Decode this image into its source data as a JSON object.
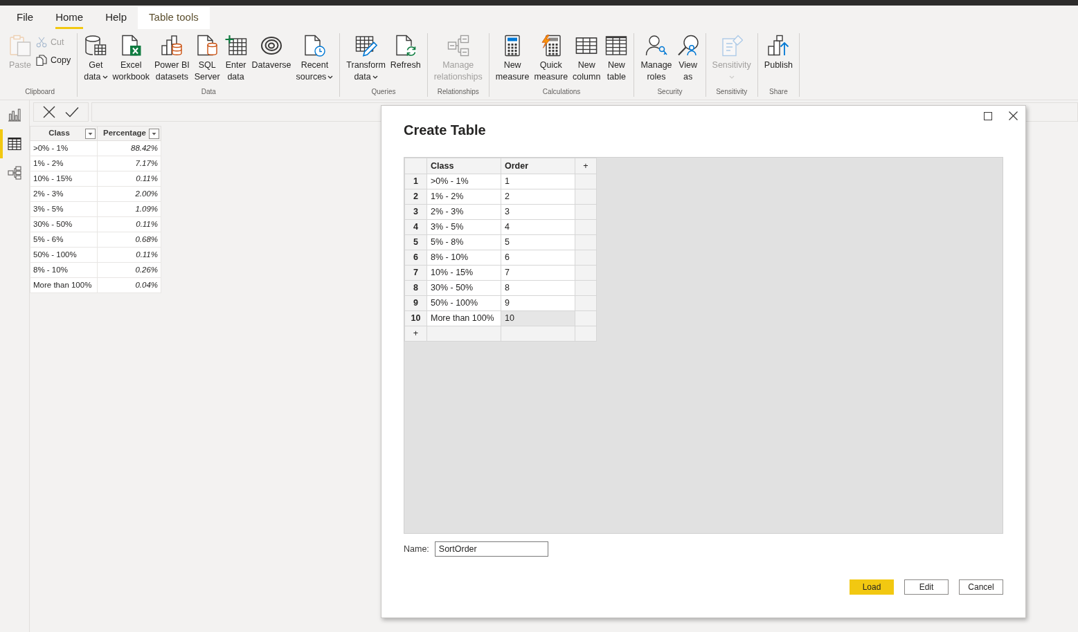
{
  "tabs": [
    {
      "label": "File",
      "selected": false,
      "kind": "standard"
    },
    {
      "label": "Home",
      "selected": true,
      "kind": "standard"
    },
    {
      "label": "Help",
      "selected": false,
      "kind": "standard"
    },
    {
      "label": "Table tools",
      "selected": false,
      "kind": "contextual"
    }
  ],
  "ribbon": {
    "groups": [
      {
        "label": "Clipboard",
        "items": [
          {
            "kind": "large",
            "lines": [
              "Paste"
            ],
            "disabled": true,
            "dropdown": false
          },
          {
            "kind": "small",
            "lines": [
              "Cut"
            ],
            "disabled": true,
            "dropdown": false
          },
          {
            "kind": "small",
            "lines": [
              "Copy"
            ],
            "disabled": false,
            "dropdown": false
          }
        ]
      },
      {
        "label": "Data",
        "items": [
          {
            "kind": "large",
            "lines": [
              "Get",
              "data"
            ],
            "disabled": false,
            "dropdown": true
          },
          {
            "kind": "large",
            "lines": [
              "Excel",
              "workbook"
            ],
            "disabled": false,
            "dropdown": false
          },
          {
            "kind": "large",
            "lines": [
              "Power BI",
              "datasets"
            ],
            "disabled": false,
            "dropdown": false
          },
          {
            "kind": "large",
            "lines": [
              "SQL",
              "Server"
            ],
            "disabled": false,
            "dropdown": false
          },
          {
            "kind": "large",
            "lines": [
              "Enter",
              "data"
            ],
            "disabled": false,
            "dropdown": false
          },
          {
            "kind": "large",
            "lines": [
              "Dataverse"
            ],
            "disabled": false,
            "dropdown": false
          },
          {
            "kind": "large",
            "lines": [
              "Recent",
              "sources"
            ],
            "disabled": false,
            "dropdown": true
          }
        ]
      },
      {
        "label": "Queries",
        "items": [
          {
            "kind": "large",
            "lines": [
              "Transform",
              "data"
            ],
            "disabled": false,
            "dropdown": true
          },
          {
            "kind": "large",
            "lines": [
              "Refresh"
            ],
            "disabled": false,
            "dropdown": false
          }
        ]
      },
      {
        "label": "Relationships",
        "items": [
          {
            "kind": "large",
            "lines": [
              "Manage",
              "relationships"
            ],
            "disabled": true,
            "dropdown": false
          }
        ]
      },
      {
        "label": "Calculations",
        "items": [
          {
            "kind": "large",
            "lines": [
              "New",
              "measure"
            ],
            "disabled": false,
            "dropdown": false
          },
          {
            "kind": "large",
            "lines": [
              "Quick",
              "measure"
            ],
            "disabled": false,
            "dropdown": false
          },
          {
            "kind": "large",
            "lines": [
              "New",
              "column"
            ],
            "disabled": false,
            "dropdown": false
          },
          {
            "kind": "large",
            "lines": [
              "New",
              "table"
            ],
            "disabled": false,
            "dropdown": false
          }
        ]
      },
      {
        "label": "Security",
        "items": [
          {
            "kind": "large",
            "lines": [
              "Manage",
              "roles"
            ],
            "disabled": false,
            "dropdown": false
          },
          {
            "kind": "large",
            "lines": [
              "View",
              "as"
            ],
            "disabled": false,
            "dropdown": false
          }
        ]
      },
      {
        "label": "Sensitivity",
        "items": [
          {
            "kind": "large",
            "lines": [
              "Sensitivity"
            ],
            "disabled": true,
            "dropdown": true
          }
        ]
      },
      {
        "label": "Share",
        "items": [
          {
            "kind": "large",
            "lines": [
              "Publish"
            ],
            "disabled": false,
            "dropdown": false
          }
        ]
      }
    ]
  },
  "view_rail": [
    {
      "selected": false
    },
    {
      "selected": true
    },
    {
      "selected": false
    }
  ],
  "data_table": {
    "columns": [
      "Class",
      "Percentage"
    ],
    "rows": [
      [
        ">0% - 1%",
        "88.42%"
      ],
      [
        "1% - 2%",
        "7.17%"
      ],
      [
        "10% - 15%",
        "0.11%"
      ],
      [
        "2% - 3%",
        "2.00%"
      ],
      [
        "3% - 5%",
        "1.09%"
      ],
      [
        "30% - 50%",
        "0.11%"
      ],
      [
        "5% - 6%",
        "0.68%"
      ],
      [
        "50% - 100%",
        "0.11%"
      ],
      [
        "8% - 10%",
        "0.26%"
      ],
      [
        "More than 100%",
        "0.04%"
      ]
    ]
  },
  "dialog": {
    "title": "Create Table",
    "columns": [
      "Class",
      "Order"
    ],
    "add_column": "+",
    "add_row": "+",
    "rows": [
      {
        "number": "1",
        "cells": [
          {
            "text": ">0% - 1%",
            "selected": false
          },
          {
            "text": "1",
            "selected": false
          }
        ]
      },
      {
        "number": "2",
        "cells": [
          {
            "text": "1% - 2%",
            "selected": false
          },
          {
            "text": "2",
            "selected": false
          }
        ]
      },
      {
        "number": "3",
        "cells": [
          {
            "text": "2% - 3%",
            "selected": false
          },
          {
            "text": "3",
            "selected": false
          }
        ]
      },
      {
        "number": "4",
        "cells": [
          {
            "text": "3% - 5%",
            "selected": false
          },
          {
            "text": "4",
            "selected": false
          }
        ]
      },
      {
        "number": "5",
        "cells": [
          {
            "text": "5% - 8%",
            "selected": false
          },
          {
            "text": "5",
            "selected": false
          }
        ]
      },
      {
        "number": "6",
        "cells": [
          {
            "text": "8% - 10%",
            "selected": false
          },
          {
            "text": "6",
            "selected": false
          }
        ]
      },
      {
        "number": "7",
        "cells": [
          {
            "text": "10% - 15%",
            "selected": false
          },
          {
            "text": "7",
            "selected": false
          }
        ]
      },
      {
        "number": "8",
        "cells": [
          {
            "text": "30% - 50%",
            "selected": false
          },
          {
            "text": "8",
            "selected": false
          }
        ]
      },
      {
        "number": "9",
        "cells": [
          {
            "text": "50% - 100%",
            "selected": false
          },
          {
            "text": "9",
            "selected": false
          }
        ]
      },
      {
        "number": "10",
        "cells": [
          {
            "text": "More than 100%",
            "selected": false
          },
          {
            "text": "10",
            "selected": true
          }
        ]
      }
    ],
    "name_label": "Name:",
    "name_value": "SortOrder",
    "buttons": [
      {
        "label": "Load",
        "kind": "primary"
      },
      {
        "label": "Edit",
        "kind": "secondary"
      },
      {
        "label": "Cancel",
        "kind": "secondary"
      }
    ]
  }
}
